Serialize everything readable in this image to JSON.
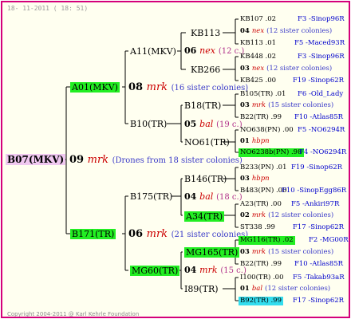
{
  "header": {
    "date": "18- 11-2011 ( 18: 51)",
    "copyright": "Copyright 2004-2011 @ Karl Kehrle Foundation"
  },
  "tree": {
    "root": "B07(MKV)",
    "gen09": {
      "num": "09",
      "mark": "mrk",
      "note": "(Drones from 18 sister colonies)"
    },
    "parents": {
      "p1": "A01(MKV)",
      "p2": "B171(TR)"
    },
    "gen08": {
      "num": "08",
      "mark": "mrk",
      "note": "(16 sister colonies)"
    },
    "gen06b": {
      "num": "06",
      "mark": "mrk",
      "note": "(21 sister colonies)"
    },
    "gp": {
      "a11": "A11(MKV)",
      "b10": "B10(TR)",
      "b175": "B175(TR)",
      "mg60": "MG60(TR)"
    },
    "gen06a": {
      "num": "06",
      "mark": "nex",
      "note": "(12 c.)"
    },
    "gen05": {
      "num": "05",
      "mark": "bal",
      "note": "(19 c.)"
    },
    "gen04a": {
      "num": "04",
      "mark": "bal",
      "note": "(18 c.)"
    },
    "gen04b": {
      "num": "04",
      "mark": "mrk",
      "note": "(15 c.)"
    },
    "ggp": {
      "kb113": "KB113",
      "kb266": "KB266",
      "b18": "B18(TR)",
      "no61": "NO61(TR)",
      "b146": "B146(TR)",
      "a34": "A34(TR)",
      "mg165": "MG165(TR)",
      "i89": "I89(TR)"
    },
    "leaves": {
      "r1": {
        "name": "KB107 .02",
        "reg": "F3 -Sinop96R"
      },
      "r2": {
        "num": "04",
        "mark": "nex",
        "note": "(12 sister colonies)"
      },
      "r3": {
        "name": "KB113 .01",
        "reg": "F5 -Maced93R"
      },
      "r4": {
        "name": "KB448 .02",
        "reg": "F3 -Sinop96R"
      },
      "r5": {
        "num": "03",
        "mark": "nex",
        "note": "(12 sister colonies)"
      },
      "r6": {
        "name": "KB425 .00",
        "reg": "F19 -Sinop62R"
      },
      "r7": {
        "name": "B105(TR) .01",
        "reg": "F6 -Old_Lady"
      },
      "r8": {
        "num": "03",
        "mark": "mrk",
        "note": "(15 sister colonies)"
      },
      "r9": {
        "name": "B22(TR) .99",
        "reg": "F10 -Atlas85R"
      },
      "r10": {
        "name": "NO638(PN) .00",
        "reg": "F5 -NO6294R"
      },
      "r11": {
        "num": "01",
        "mark": "hbpn"
      },
      "r12": {
        "name": "NO6238b(PN) .98",
        "reg": "F4 -NO6294R"
      },
      "r13": {
        "name": "B233(PN) .01",
        "reg": "F19 -Sinop62R"
      },
      "r14": {
        "num": "03",
        "mark": "hbpn"
      },
      "r15": {
        "name": "B483(PN) .00",
        "reg": "F10 -SinopEgg86R"
      },
      "r16": {
        "name": "A23(TR) .00",
        "reg": "F5 -Ankiri97R"
      },
      "r17": {
        "num": "02",
        "mark": "mrk",
        "note": "(12 sister colonies)"
      },
      "r18": {
        "name": "ST338 .99",
        "reg": "F17 -Sinop62R"
      },
      "r19": {
        "name": "MG116(TR) .02",
        "reg": "F2 -MG00R"
      },
      "r20": {
        "num": "03",
        "mark": "mrk",
        "note": "(15 sister colonies)"
      },
      "r21": {
        "name": "B22(TR) .99",
        "reg": "F10 -Atlas85R"
      },
      "r22": {
        "name": "I100(TR) .00",
        "reg": "F5 -Takab93aR"
      },
      "r23": {
        "num": "01",
        "mark": "bal",
        "note": "(12 sister colonies)"
      },
      "r24": {
        "name": "B92(TR) .99",
        "reg": "F17 -Sinop62R"
      }
    }
  }
}
